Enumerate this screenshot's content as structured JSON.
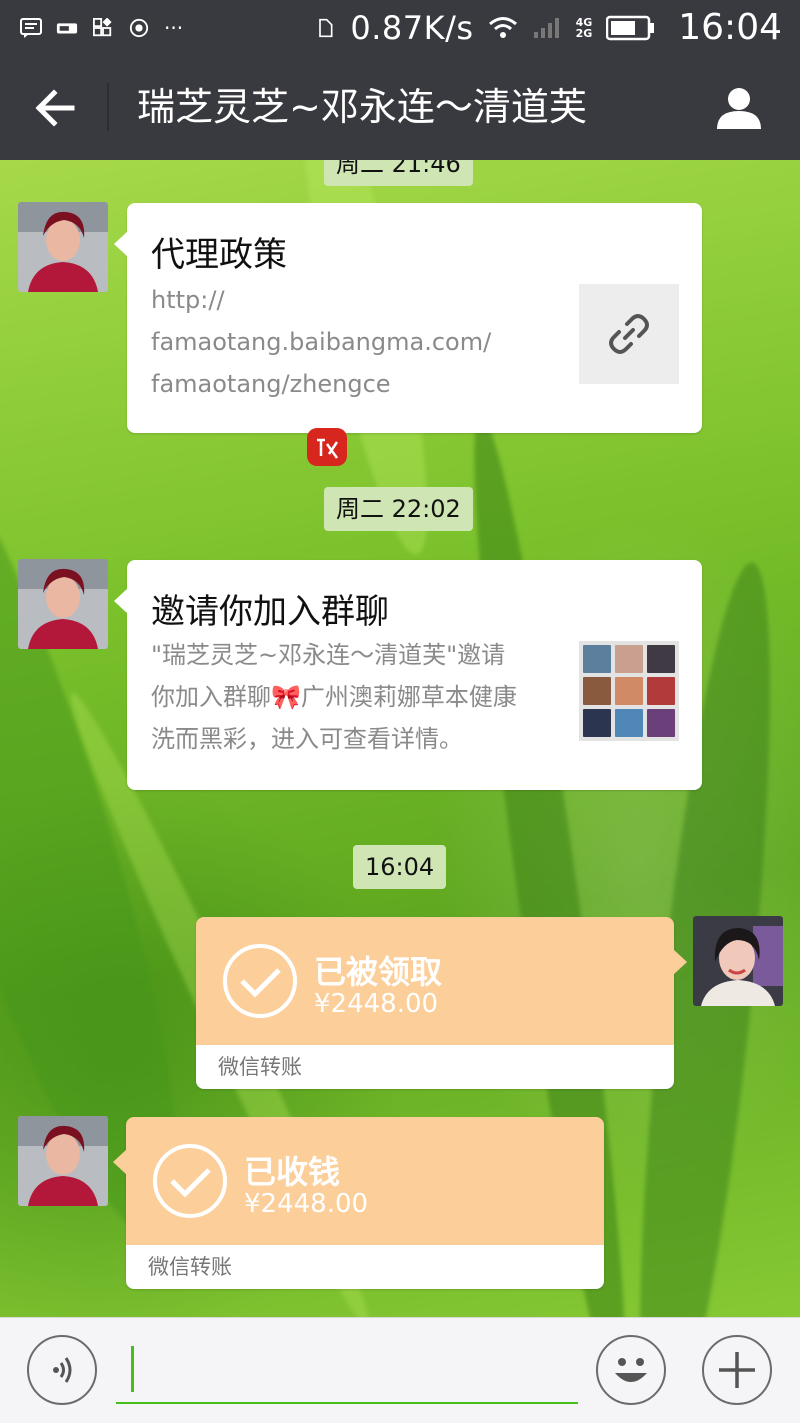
{
  "status_bar": {
    "net_speed": "0.87K/s",
    "signal_label_top": "4G",
    "signal_label_bottom": "2G",
    "time": "16:04"
  },
  "header": {
    "title": "瑞芝灵芝~邓永连～清道芙"
  },
  "messages": {
    "partial_timestamp": "周二 21:46",
    "timestamp_1": "周二 22:02",
    "timestamp_2": "16:04",
    "link_card": {
      "title": "代理政策",
      "url_lines": [
        "http://",
        "famaotang.baibangma.com/",
        "famaotang/zhengce"
      ]
    },
    "invite_card": {
      "title": "邀请你加入群聊",
      "lines": [
        "\"瑞芝灵芝~邓永连～清道芙\"邀请",
        "你加入群聊🎀广州澳莉娜草本健康",
        "洗而黑彩，进入可查看详情。"
      ]
    },
    "transfer_sent": {
      "status": "已被领取",
      "amount": "¥2448.00",
      "footer": "微信转账"
    },
    "transfer_received": {
      "status": "已收钱",
      "amount": "¥2448.00",
      "footer": "微信转账"
    }
  },
  "input_bar": {
    "text": ""
  },
  "colors": {
    "bar": "#393a3f",
    "accent": "#45c01a",
    "transfer": "#fbce9a"
  }
}
